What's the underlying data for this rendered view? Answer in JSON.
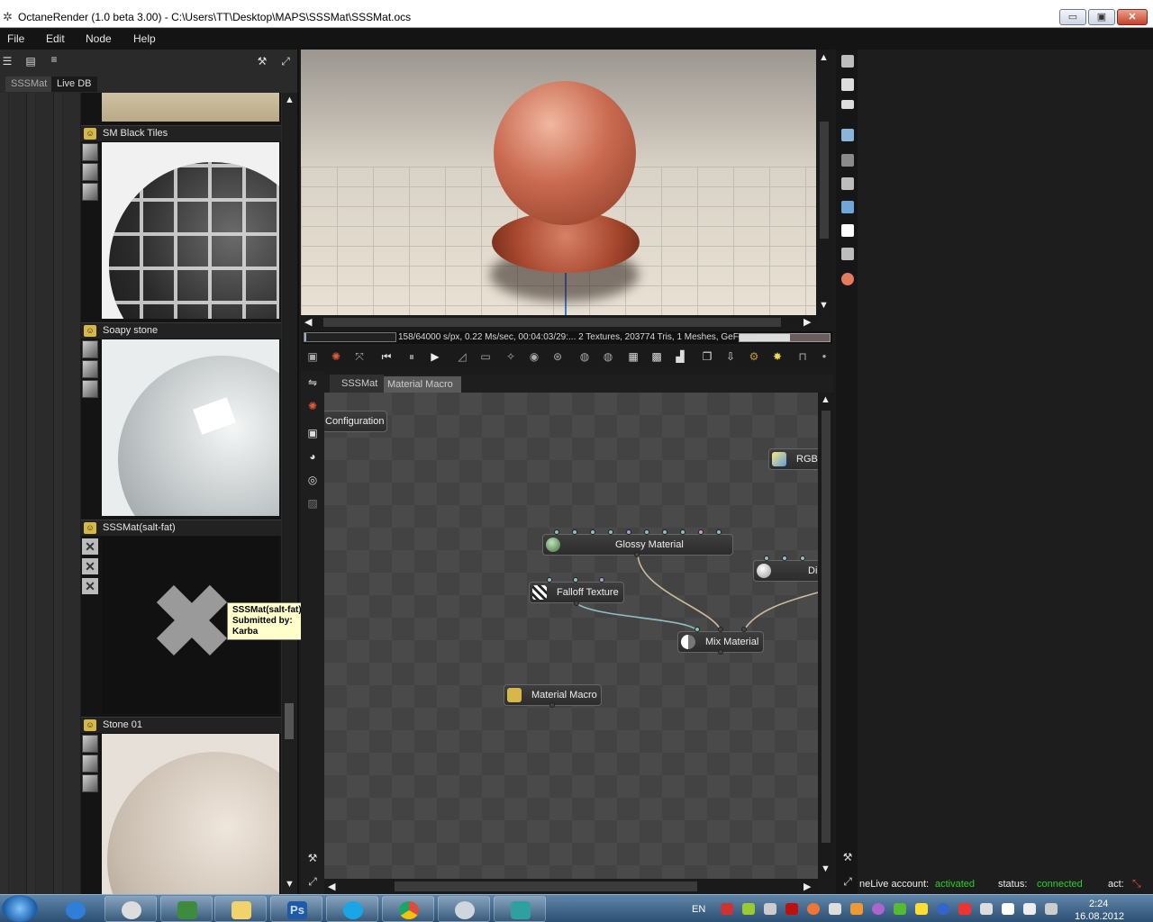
{
  "window": {
    "title": "OctaneRender (1.0 beta 3.00) - C:\\Users\\TT\\Desktop\\MAPS\\SSSMat\\SSSMat.ocs",
    "minimize": "▭",
    "restore": "▣",
    "close": "✕"
  },
  "menu": [
    "File",
    "Edit",
    "Node",
    "Help"
  ],
  "left_panel": {
    "tabs": [
      "SSSMat",
      "Live DB"
    ],
    "items": [
      {
        "title": "SM Black Tiles"
      },
      {
        "title": "Soapy stone"
      },
      {
        "title": "SSSMat(salt-fat)"
      },
      {
        "title": "Stone 01"
      }
    ],
    "tooltip": {
      "name": "SSSMat(salt-fat)",
      "submitted": "Submitted by:",
      "author": "Karba"
    }
  },
  "viewport": {
    "status": "158/64000 s/px, 0.22 Ms/sec, 00:04:03/29:... 2 Textures, 203774 Tris, 1 Meshes, GeForce ...",
    "progress": 0.02
  },
  "node_editor": {
    "tabs": [
      "SSSMat",
      "Material Macro"
    ],
    "nodes": {
      "configuration": "Configuration",
      "rgb": "RGBS",
      "glossy": "Glossy Material",
      "diffuse": "Di",
      "falloff": "Falloff Texture",
      "mix": "Mix Material",
      "macro": "Material Macro"
    }
  },
  "status_bar": {
    "account_label": "neLive account:",
    "account_value": "activated",
    "status_label": "status:",
    "status_value": "connected",
    "act_label": "act:",
    "ok_color": "#27d227"
  },
  "taskbar": {
    "lang": "EN",
    "time": "2:24",
    "date": "16.08.2012",
    "ps_label": "Ps"
  }
}
